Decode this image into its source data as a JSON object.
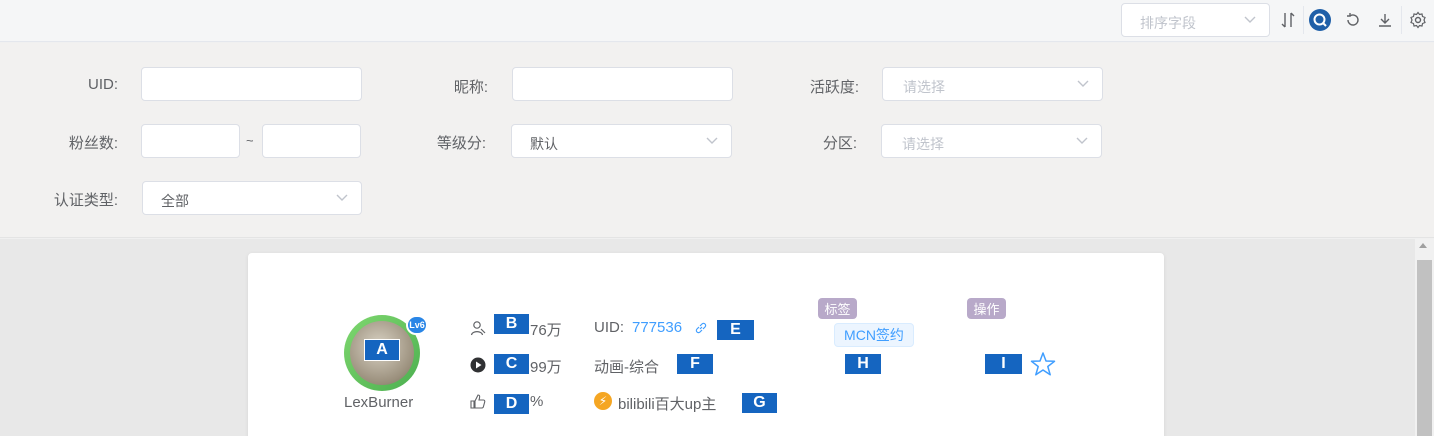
{
  "toolbar": {
    "sort_placeholder": "排序字段",
    "icons": [
      "sort-toggle-icon",
      "search-icon",
      "refresh-icon",
      "download-icon",
      "settings-icon"
    ],
    "accent_color": "#1f5fa8"
  },
  "filters": {
    "uid_label": "UID:",
    "nickname_label": "昵称:",
    "activity_label": "活跃度:",
    "activity_placeholder": "请选择",
    "fans_label": "粉丝数:",
    "fans_separator": "~",
    "level_label": "等级分:",
    "level_value": "默认",
    "partition_label": "分区:",
    "partition_placeholder": "请选择",
    "cert_label": "认证类型:",
    "cert_value": "全部"
  },
  "card": {
    "username": "LexBurner",
    "level_badge": "Lv6",
    "fans_text": "76万",
    "plays_text": "99万",
    "like_text": "%",
    "uid_label": "UID:",
    "uid_value": "777536",
    "partition": "动画-综合",
    "certification": "bilibili百大up主",
    "tag_header": "标签",
    "action_header": "操作",
    "mcn_tag": "MCN签约"
  },
  "markers": {
    "A": "A",
    "B": "B",
    "C": "C",
    "D": "D",
    "E": "E",
    "F": "F",
    "G": "G",
    "H": "H",
    "I": "I"
  }
}
